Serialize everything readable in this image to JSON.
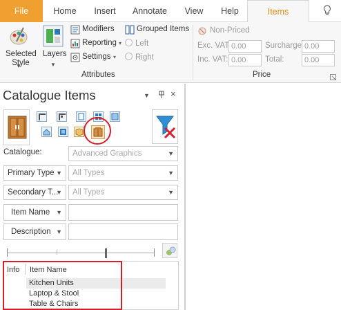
{
  "tabs": [
    {
      "label": "File"
    },
    {
      "label": "Home"
    },
    {
      "label": "Insert"
    },
    {
      "label": "Annotate"
    },
    {
      "label": "View"
    },
    {
      "label": "Help"
    },
    {
      "label": "Items"
    }
  ],
  "ribbon": {
    "selected_style": "Selected Style",
    "layers": "Layers",
    "modifiers": "Modifiers",
    "reporting": "Reporting",
    "settings": "Settings",
    "grouped_items": "Grouped Items",
    "left": "Left",
    "right": "Right",
    "attributes_label": "Attributes",
    "non_priced": "Non-Priced",
    "exc_vat_label": "Exc. VAT:",
    "exc_vat_value": "0.00",
    "surcharge_label": "Surcharge:",
    "surcharge_value": "0.00",
    "inc_vat_label": "Inc. VAT:",
    "inc_vat_value": "0.00",
    "total_label": "Total:",
    "total_value": "0.00",
    "price_label": "Price"
  },
  "pane": {
    "title": "Catalogue Items",
    "catalogue_label": "Catalogue:",
    "catalogue_value": "Advanced Graphics",
    "primary_type_label": "Primary Type",
    "primary_type_value": "All Types",
    "secondary_type_label": "Secondary T...",
    "secondary_type_value": "All Types",
    "item_name_label": "Item Name",
    "description_label": "Description",
    "list_headers": {
      "info": "Info",
      "item_name": "Item Name"
    },
    "items": [
      "Kitchen Units",
      "Laptop & Stool",
      "Table & Chairs"
    ]
  },
  "colors": {
    "accent": "#f0a030",
    "highlight": "#d21f2b",
    "selected_row": "#ebebeb"
  },
  "icons": [
    "paint-palette-icon",
    "layers-icon",
    "modifiers-icon",
    "reporting-icon",
    "settings-icon",
    "grouped-items-icon",
    "lightbulb-icon",
    "cabinet-icon",
    "filter-clear-icon",
    "tools-icon"
  ]
}
